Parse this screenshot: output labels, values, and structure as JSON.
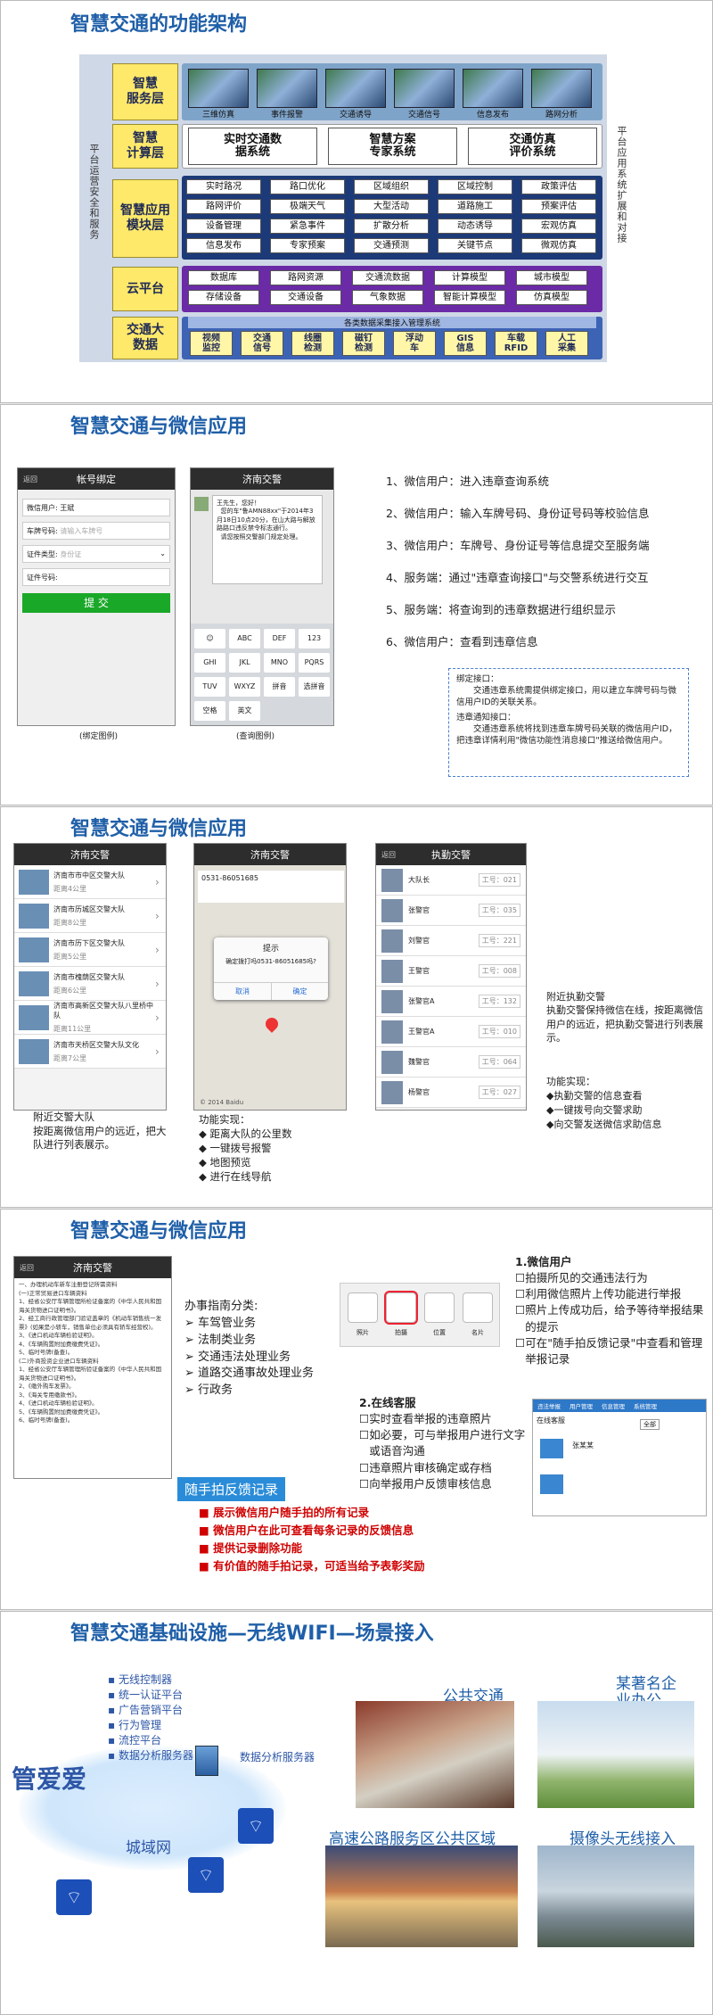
{
  "s1": {
    "title": "智慧交通的功能架构",
    "left_side": "平台运营安全和服务",
    "right_side": "平台应用系统扩展和对接",
    "layers": [
      "智慧\n服务层",
      "智慧\n计算层",
      "智慧应用\n模块层",
      "云平台",
      "交通大\n数据"
    ],
    "service": [
      "三维仿真",
      "事件报警",
      "交通诱导",
      "交通信号",
      "信息发布",
      "路网分析"
    ],
    "compute": [
      "实时交通数\n据系统",
      "智慧方案\n专家系统",
      "交通仿真\n评价系统"
    ],
    "apps": [
      "实时路况",
      "路口优化",
      "区域组织",
      "区域控制",
      "政策评估",
      "路网评价",
      "极端天气",
      "大型活动",
      "道路施工",
      "预案评估",
      "设备管理",
      "紧急事件",
      "扩散分析",
      "动态诱导",
      "宏观仿真",
      "信息发布",
      "专家预案",
      "交通预测",
      "关键节点",
      "微观仿真"
    ],
    "cloud": [
      "数据库",
      "路网资源",
      "交通流数据",
      "计算模型",
      "城市模型",
      "存储设备",
      "交通设备",
      "气象数据",
      "智能计算模型",
      "仿真模型"
    ],
    "bigdata_header": "各类数据采集接入管理系统",
    "bigdata": [
      "视频\n监控",
      "交通\n信号",
      "线圈\n检测",
      "磁钉\n检测",
      "浮动\n车",
      "GIS\n信息",
      "车载\nRFID",
      "人工\n采集"
    ]
  },
  "s2": {
    "title": "智慧交通与微信应用",
    "phone1": {
      "back": "返回",
      "title": "帐号绑定",
      "f1": "微信用户:",
      "v1": "王斌",
      "f2": "车牌号码:",
      "p2": "请输入车牌号",
      "f3": "证件类型:",
      "p3": "身份证",
      "f4": "证件号码:",
      "submit": "提 交",
      "caption": "(绑定图例)"
    },
    "phone2": {
      "title": "济南交警",
      "msg": "王先生，您好！\n  您的车\"鲁AMN88xx\"于2014年3月18日10点20分，在山大路与解放路路口违反禁令标志通行。\n  请您按照交警部门规定处理。",
      "keys": [
        "☺",
        "ABC",
        "DEF",
        "123",
        "GHI",
        "JKL",
        "MNO",
        "PQRS",
        "TUV",
        "WXYZ",
        "拼音",
        "选拼音",
        "空格",
        "英文"
      ],
      "caption": "(查询图例)"
    },
    "steps": [
      "1、微信用户：进入违章查询系统",
      "2、微信用户：输入车牌号码、身份证号码等校验信息",
      "3、微信用户：车牌号、身份证号等信息提交至服务端",
      "4、服务端：通过\"违章查询接口\"与交警系统进行交互",
      "5、服务端：将查询到的违章数据进行组织显示",
      "6、微信用户：查看到违章信息"
    ],
    "note1_h": "绑定接口：",
    "note1": "交通违章系统需提供绑定接口，用以建立车牌号码与微信用户ID的关联关系。",
    "note2_h": "违章通知接口：",
    "note2": "交通违章系统将找到违章车牌号码关联的微信用户ID，把违章详情利用\"微信功能性消息接口\"推送给微信用户。"
  },
  "s3": {
    "title": "智慧交通与微信应用",
    "phone1": {
      "title": "济南交警",
      "rows": [
        "济南市市中区交警大队",
        "济南市历城区交警大队",
        "济南市历下区交警大队",
        "济南市槐荫区交警大队",
        "济南市高新区交警大队八里桥中队",
        "济南市天桥区交警大队文化"
      ],
      "dist": [
        "距离4公里",
        "距离8公里",
        "距离5公里",
        "距离6公里",
        "距离11公里",
        "距离7公里"
      ]
    },
    "phone2": {
      "title": "济南交警",
      "addr": "0531-86051685",
      "dialog_title": "提示",
      "dialog_msg": "确定拨打吗0531-86051685吗?",
      "cancel": "取消",
      "ok": "确定",
      "map_credit": "© 2014 Baidu"
    },
    "phone3": {
      "back": "返回",
      "title": "执勤交警",
      "names": [
        "大队长",
        "张警官",
        "刘警官",
        "王警官",
        "张警官A",
        "王警官A",
        "魏警官",
        "杨警官"
      ],
      "nums": [
        "工号：021",
        "工号：035",
        "工号：221",
        "工号：008",
        "工号：132",
        "工号：010",
        "工号：064",
        "工号：027"
      ]
    },
    "cap1": "附近交警大队\n按距离微信用户的远近，把大队进行列表展示。",
    "cap2_h": "功能实现：",
    "cap2": [
      "距离大队的公里数",
      "一键拨号报警",
      "地图预览",
      "进行在线导航"
    ],
    "cap3": "附近执勤交警\n执勤交警保持微信在线，按距离微信用户的远近，把执勤交警进行列表展示。",
    "cap4_h": "功能实现：",
    "cap4": [
      "◆执勤交警的信息查看",
      "◆一键拨号向交警求助",
      "◆向交警发送微信求助信息"
    ]
  },
  "s4": {
    "title": "智慧交通与微信应用",
    "doc_phone": {
      "back": "返回",
      "title": "济南交警",
      "lines": [
        "一、办理机动车新车注册登记所需资料",
        "(一)正常贸易进口车辆资料",
        "1、经省公安厅车辆管理所检证备案的《中华人民共和国海关货物进口证明书》。",
        "2、经工商行政管理部门验证盖章的《机动车销售统一发票》(如果是小轿车，销售单位必须具有轿车经营权)。",
        "3、《进口机动车辆检验证明》。",
        "4、《车辆购置附加费缴费凭证》。",
        "5、临时号牌(备查)。",
        "(二)外商投资企业进口车辆资料",
        "1、经省公安厅车辆管理所验证备案的《中华人民共和国海关货物进口证明书》。",
        "2、《缴外购车发票》。",
        "3、《海关专用缴款书》。",
        "4、《进口机动车辆检验证明》。",
        "5、《车辆购置附加费缴费凭证》。",
        "6、临时号牌(备查)。"
      ]
    },
    "guide_h": "办事指南分类:",
    "guide": [
      "车驾管业务",
      "法制类业务",
      "交通违法处理业务",
      "道路交通事故处理业务",
      "行政务"
    ],
    "tool_labels": [
      "照片",
      "拍摄",
      "位置",
      "名片"
    ],
    "p1_h": "1.微信用户",
    "p1": [
      "拍摄所见的交通违法行为",
      "利用微信照片上传功能进行举报",
      "照片上传成功后，给予等待举报结果的提示",
      "可在\"随手拍反馈记录\"中查看和管理举报记录"
    ],
    "p2_h": "2.在线客服",
    "p2": [
      "实时查看举报的违章照片",
      "如必要，可与举报用户进行文字或语音沟通",
      "违章照片审核确定或存档",
      "向举报用户反馈审核信息"
    ],
    "btn": "随手拍反馈记录",
    "red": [
      "展示微信用户随手拍的所有记录",
      "微信用户在此可查看每条记录的反馈信息",
      "提供记录删除功能",
      "有价值的随手拍记录，可适当给予表彰奖励"
    ],
    "web_tabs": [
      "违法举报",
      "用户管理",
      "信息管理",
      "系统管理"
    ],
    "web_label": "在线客服",
    "web_user": "张某某",
    "web_sel": "全部"
  },
  "s5": {
    "title": "智慧交通基础设施—无线WIFI—场景接入",
    "servers": [
      "无线控制器",
      "统一认证平台",
      "广告营销平台",
      "行为管理",
      "流控平台",
      "数据分析服务器"
    ],
    "server_lbl": "数据分析服务器",
    "brand": "管爱爱",
    "cloud": "城域网",
    "scenes": [
      "公共交通",
      "某著名企\n业办公",
      "高速公路服务区公共区域",
      "摄像头无线接入"
    ]
  }
}
